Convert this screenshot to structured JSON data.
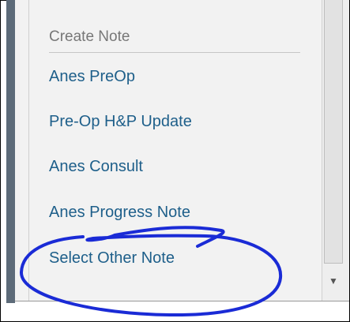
{
  "menu": {
    "header": "Create Note",
    "items": [
      {
        "label": "Anes PreOp"
      },
      {
        "label": "Pre-Op H&P Update"
      },
      {
        "label": "Anes Consult"
      },
      {
        "label": "Anes Progress Note"
      },
      {
        "label": "Select Other Note"
      }
    ]
  },
  "scrollbar": {
    "down_arrow": "▼"
  },
  "colors": {
    "link": "#1e5f8a",
    "header": "#777777",
    "annotation": "#1a2bd6",
    "left_bar": "#5d6b79"
  }
}
